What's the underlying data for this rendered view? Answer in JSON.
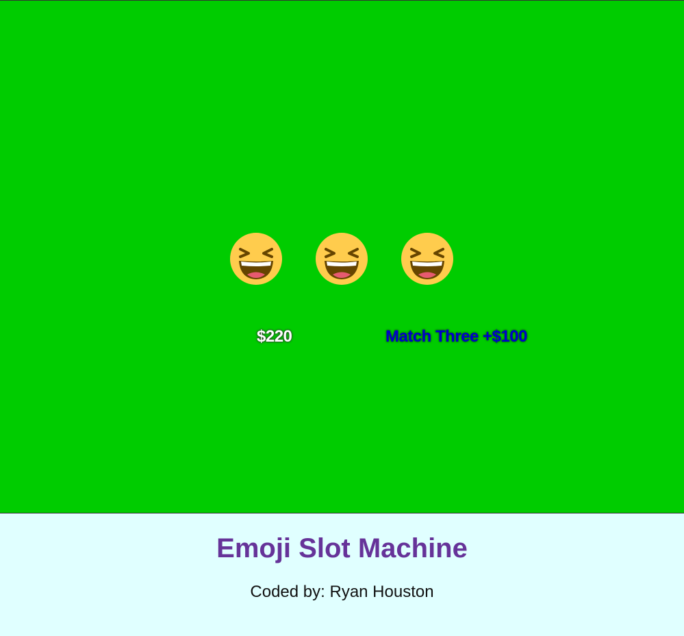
{
  "game": {
    "background_color": "#00cc00",
    "reels": [
      {
        "symbol": "😆",
        "icon": "laughing-face-icon"
      },
      {
        "symbol": "😆",
        "icon": "laughing-face-icon"
      },
      {
        "symbol": "😆",
        "icon": "laughing-face-icon"
      }
    ],
    "money": "$220",
    "result": "Match Three +$100"
  },
  "footer": {
    "title": "Emoji Slot Machine",
    "credit": "Coded by: Ryan Houston",
    "title_color": "#663399",
    "background_color": "#e0ffff"
  }
}
